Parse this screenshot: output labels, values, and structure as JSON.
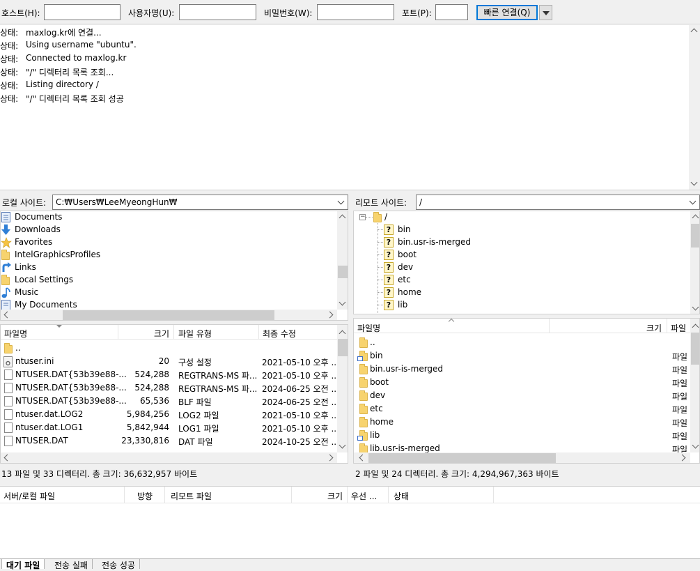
{
  "quickconnect": {
    "host_label": "호스트(H):",
    "user_label": "사용자명(U):",
    "pass_label": "비밀번호(W):",
    "port_label": "포트(P):",
    "host_value": "",
    "user_value": "",
    "pass_value": "",
    "port_value": "",
    "connect_button": "빠른 연결(Q)"
  },
  "log": [
    {
      "key": "상태:",
      "text": "maxlog.kr에 연결..."
    },
    {
      "key": "상태:",
      "text": "Using username \"ubuntu\"."
    },
    {
      "key": "상태:",
      "text": "Connected to maxlog.kr"
    },
    {
      "key": "상태:",
      "text": "\"/\" 디렉터리 목록 조회..."
    },
    {
      "key": "상태:",
      "text": "Listing directory /"
    },
    {
      "key": "상태:",
      "text": "\"/\" 디렉터리 목록 조회 성공"
    }
  ],
  "local": {
    "site_label": "로컬 사이트:",
    "path": "C:₩Users₩LeeMyeongHun₩",
    "tree": [
      {
        "icon": "document-icon",
        "name": "Documents"
      },
      {
        "icon": "download-icon",
        "name": "Downloads"
      },
      {
        "icon": "star-icon",
        "name": "Favorites"
      },
      {
        "icon": "folder-icon",
        "name": "IntelGraphicsProfiles"
      },
      {
        "icon": "link-arrow-icon",
        "name": "Links"
      },
      {
        "icon": "folder-icon",
        "name": "Local Settings"
      },
      {
        "icon": "music-icon",
        "name": "Music"
      },
      {
        "icon": "document-icon",
        "name": "My Documents"
      }
    ],
    "columns": {
      "name": "파일명",
      "size": "크기",
      "type": "파일 유형",
      "modified": "최종 수정"
    },
    "files": [
      {
        "name": "..",
        "size": "",
        "type": "",
        "modified": "",
        "icon": "folder"
      },
      {
        "name": "ntuser.ini",
        "size": "20",
        "type": "구성 설정",
        "modified": "2021-05-10 오후 ...",
        "icon": "ini"
      },
      {
        "name": "NTUSER.DAT{53b39e88-...",
        "size": "524,288",
        "type": "REGTRANS-MS 파...",
        "modified": "2021-05-10 오후 ...",
        "icon": "file"
      },
      {
        "name": "NTUSER.DAT{53b39e88-...",
        "size": "524,288",
        "type": "REGTRANS-MS 파...",
        "modified": "2024-06-25 오전 ...",
        "icon": "file"
      },
      {
        "name": "NTUSER.DAT{53b39e88-...",
        "size": "65,536",
        "type": "BLF 파일",
        "modified": "2024-06-25 오전 ...",
        "icon": "file"
      },
      {
        "name": "ntuser.dat.LOG2",
        "size": "5,984,256",
        "type": "LOG2 파일",
        "modified": "2021-05-10 오후 ...",
        "icon": "file"
      },
      {
        "name": "ntuser.dat.LOG1",
        "size": "5,842,944",
        "type": "LOG1 파일",
        "modified": "2021-05-10 오후 ...",
        "icon": "file"
      },
      {
        "name": "NTUSER.DAT",
        "size": "23,330,816",
        "type": "DAT 파일",
        "modified": "2024-10-25 오전 ...",
        "icon": "file"
      }
    ],
    "status": "13 파일 및 33 디렉터리. 총 크기: 36,632,957 바이트"
  },
  "remote": {
    "site_label": "리모트 사이트:",
    "path": "/",
    "tree_root": "/",
    "tree": [
      "bin",
      "bin.usr-is-merged",
      "boot",
      "dev",
      "etc",
      "home",
      "lib"
    ],
    "columns": {
      "name": "파일명",
      "size": "크기",
      "type": "파일"
    },
    "files": [
      {
        "name": "..",
        "type": "",
        "link": false
      },
      {
        "name": "bin",
        "type": "파일",
        "link": true
      },
      {
        "name": "bin.usr-is-merged",
        "type": "파일",
        "link": false
      },
      {
        "name": "boot",
        "type": "파일",
        "link": false
      },
      {
        "name": "dev",
        "type": "파일",
        "link": false
      },
      {
        "name": "etc",
        "type": "파일",
        "link": false
      },
      {
        "name": "home",
        "type": "파일",
        "link": false
      },
      {
        "name": "lib",
        "type": "파일",
        "link": true
      },
      {
        "name": "lib.usr-is-merged",
        "type": "파일",
        "link": false
      }
    ],
    "status": "2 파일 및 24 디렉터리. 총 크기: 4,294,967,363 바이트"
  },
  "queue": {
    "columns": {
      "server_file": "서버/로컬 파일",
      "direction": "방향",
      "remote_file": "리모트 파일",
      "size": "크기",
      "priority": "우선 ...",
      "status": "상태"
    },
    "tabs": [
      "대기 파일",
      "전송 실패",
      "전송 성공"
    ]
  }
}
